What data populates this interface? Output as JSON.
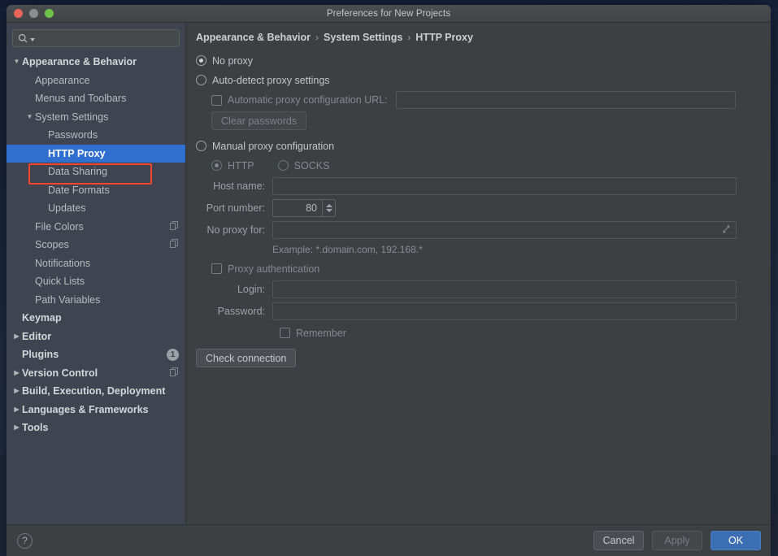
{
  "window": {
    "title": "Preferences for New Projects",
    "traffic_lights": [
      "close-light",
      "minimize-light",
      "maximize-light"
    ]
  },
  "sidebar": {
    "search": {
      "placeholder": "",
      "value": "",
      "icon": "search-icon"
    },
    "items": [
      {
        "label": "Appearance & Behavior",
        "indent": 0,
        "twisty": "▼",
        "bold": true,
        "selected": false,
        "badge": ""
      },
      {
        "label": "Appearance",
        "indent": 1,
        "twisty": "",
        "bold": false,
        "selected": false,
        "badge": ""
      },
      {
        "label": "Menus and Toolbars",
        "indent": 1,
        "twisty": "",
        "bold": false,
        "selected": false,
        "badge": ""
      },
      {
        "label": "System Settings",
        "indent": 1,
        "twisty": "▼",
        "bold": false,
        "selected": false,
        "badge": ""
      },
      {
        "label": "Passwords",
        "indent": 2,
        "twisty": "",
        "bold": false,
        "selected": false,
        "badge": ""
      },
      {
        "label": "HTTP Proxy",
        "indent": 2,
        "twisty": "",
        "bold": false,
        "selected": true,
        "badge": ""
      },
      {
        "label": "Data Sharing",
        "indent": 2,
        "twisty": "",
        "bold": false,
        "selected": false,
        "badge": ""
      },
      {
        "label": "Date Formats",
        "indent": 2,
        "twisty": "",
        "bold": false,
        "selected": false,
        "badge": ""
      },
      {
        "label": "Updates",
        "indent": 2,
        "twisty": "",
        "bold": false,
        "selected": false,
        "badge": ""
      },
      {
        "label": "File Colors",
        "indent": 1,
        "twisty": "",
        "bold": false,
        "selected": false,
        "badge": "copy"
      },
      {
        "label": "Scopes",
        "indent": 1,
        "twisty": "",
        "bold": false,
        "selected": false,
        "badge": "copy"
      },
      {
        "label": "Notifications",
        "indent": 1,
        "twisty": "",
        "bold": false,
        "selected": false,
        "badge": ""
      },
      {
        "label": "Quick Lists",
        "indent": 1,
        "twisty": "",
        "bold": false,
        "selected": false,
        "badge": ""
      },
      {
        "label": "Path Variables",
        "indent": 1,
        "twisty": "",
        "bold": false,
        "selected": false,
        "badge": ""
      },
      {
        "label": "Keymap",
        "indent": 0,
        "twisty": "",
        "bold": true,
        "selected": false,
        "badge": ""
      },
      {
        "label": "Editor",
        "indent": 0,
        "twisty": "▶",
        "bold": true,
        "selected": false,
        "badge": ""
      },
      {
        "label": "Plugins",
        "indent": 0,
        "twisty": "",
        "bold": true,
        "selected": false,
        "badge": "1"
      },
      {
        "label": "Version Control",
        "indent": 0,
        "twisty": "▶",
        "bold": true,
        "selected": false,
        "badge": "copy"
      },
      {
        "label": "Build, Execution, Deployment",
        "indent": 0,
        "twisty": "▶",
        "bold": true,
        "selected": false,
        "badge": ""
      },
      {
        "label": "Languages & Frameworks",
        "indent": 0,
        "twisty": "▶",
        "bold": true,
        "selected": false,
        "badge": ""
      },
      {
        "label": "Tools",
        "indent": 0,
        "twisty": "▶",
        "bold": true,
        "selected": false,
        "badge": ""
      }
    ],
    "annotation": {
      "color": "#f4452f",
      "targets": "HTTP Proxy"
    }
  },
  "main": {
    "breadcrumb": [
      "Appearance & Behavior",
      "System Settings",
      "HTTP Proxy"
    ],
    "breadcrumb_separator": "›",
    "no_proxy": {
      "label": "No proxy",
      "selected": true
    },
    "auto_detect": {
      "label": "Auto-detect proxy settings",
      "selected": false
    },
    "auto_config_url": {
      "label": "Automatic proxy configuration URL:",
      "checked": false,
      "value": ""
    },
    "clear_passwords": {
      "label": "Clear passwords",
      "enabled": false
    },
    "manual": {
      "label": "Manual proxy configuration",
      "selected": false
    },
    "protocol": {
      "http": {
        "label": "HTTP",
        "selected": true
      },
      "socks": {
        "label": "SOCKS",
        "selected": false
      }
    },
    "host_name": {
      "label": "Host name:",
      "value": ""
    },
    "port_number": {
      "label": "Port number:",
      "value": "80"
    },
    "no_proxy_for": {
      "label": "No proxy for:",
      "value": "",
      "resize_icon": "resize-handle-icon"
    },
    "example_hint": "Example: *.domain.com, 192.168.*",
    "proxy_auth": {
      "label": "Proxy authentication",
      "checked": false
    },
    "login": {
      "label": "Login:",
      "value": ""
    },
    "password": {
      "label": "Password:",
      "value": ""
    },
    "remember": {
      "label": "Remember",
      "checked": false
    },
    "check_connection": {
      "label": "Check connection",
      "enabled": true
    }
  },
  "footer": {
    "help": {
      "label": "?"
    },
    "cancel": {
      "label": "Cancel",
      "state": "enabled"
    },
    "apply": {
      "label": "Apply",
      "state": "disabled"
    },
    "ok": {
      "label": "OK",
      "state": "primary"
    }
  },
  "colors": {
    "selection_blue": "#2f6fd0",
    "annotation_red": "#f4452f",
    "primary_button": "#3c6eb4",
    "sidebar_bg": "#3f4450",
    "panel_bg": "#3c4043"
  }
}
